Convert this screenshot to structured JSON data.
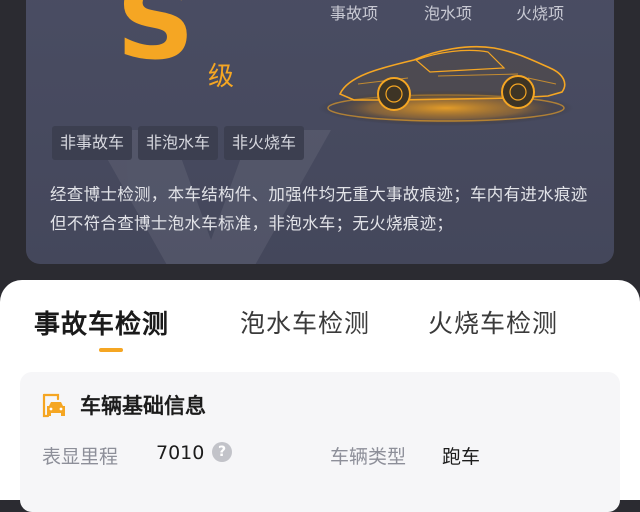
{
  "report": {
    "grade_letter": "S",
    "grade_suffix": "级",
    "check_items": [
      "事故项",
      "泡水项",
      "火烧项"
    ],
    "tags": [
      "非事故车",
      "非泡水车",
      "非火烧车"
    ],
    "description": "经查博士检测，本车结构件、加强件均无重大事故痕迹；车内有进水痕迹但不符合查博士泡水车标准，非泡水车；无火烧痕迹；",
    "accent_color": "#f5a623"
  },
  "tabs": [
    {
      "label": "事故车检测",
      "active": true
    },
    {
      "label": "泡水车检测",
      "active": false
    },
    {
      "label": "火烧车检测",
      "active": false
    }
  ],
  "vehicle_info": {
    "title": "车辆基础信息",
    "icon": "car-document-icon",
    "fields": [
      {
        "label": "表显里程",
        "value": "7010",
        "help_icon": "question-icon"
      },
      {
        "label": "车辆类型",
        "value": "跑车"
      }
    ]
  }
}
